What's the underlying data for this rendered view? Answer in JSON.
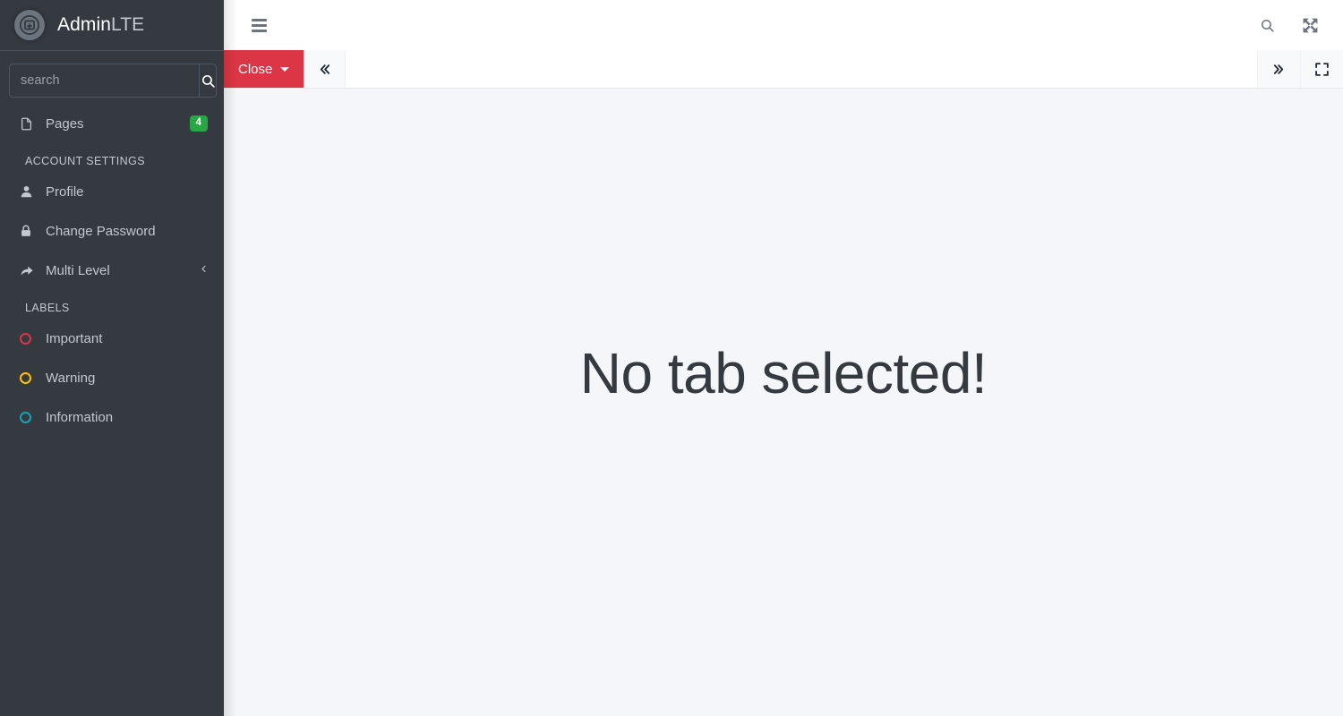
{
  "brand": {
    "name_bold": "Admin",
    "name_light": "LTE",
    "logo_icon": "adminlte-logo-icon"
  },
  "sidebar": {
    "search": {
      "placeholder": "search",
      "value": "",
      "button_icon": "search-icon"
    },
    "items": [
      {
        "label": "Pages",
        "icon": "file-icon",
        "badge": "4"
      }
    ],
    "sections": [
      {
        "header": "ACCOUNT SETTINGS",
        "items": [
          {
            "label": "Profile",
            "icon": "user-icon"
          },
          {
            "label": "Change Password",
            "icon": "lock-icon"
          },
          {
            "label": "Multi Level",
            "icon": "share-arrow-icon",
            "arrow": "chevron-left-icon"
          }
        ]
      },
      {
        "header": "LABELS",
        "items": [
          {
            "label": "Important",
            "icon": "circle-outline-icon",
            "color": "#dc3545"
          },
          {
            "label": "Warning",
            "icon": "circle-outline-icon",
            "color": "#ffc107"
          },
          {
            "label": "Information",
            "icon": "circle-outline-icon",
            "color": "#17a2b8"
          }
        ]
      }
    ]
  },
  "navbar": {
    "menu_toggle_icon": "hamburger-icon",
    "search_icon": "search-icon",
    "fullscreen_icon": "expand-arrows-icon"
  },
  "tabbar": {
    "close_label": "Close",
    "close_caret_icon": "caret-down-icon",
    "scroll_left_icon": "angle-double-left-icon",
    "scroll_right_icon": "angle-double-right-icon",
    "expand_icon": "expand-frame-icon",
    "tabs": []
  },
  "content": {
    "empty_message": "No tab selected!"
  },
  "colors": {
    "sidebar_bg": "#343a40",
    "content_bg": "#f4f6f9",
    "danger": "#dc3545",
    "success": "#28a745",
    "warning": "#ffc107",
    "info": "#17a2b8",
    "navbar_bg": "#ffffff"
  }
}
